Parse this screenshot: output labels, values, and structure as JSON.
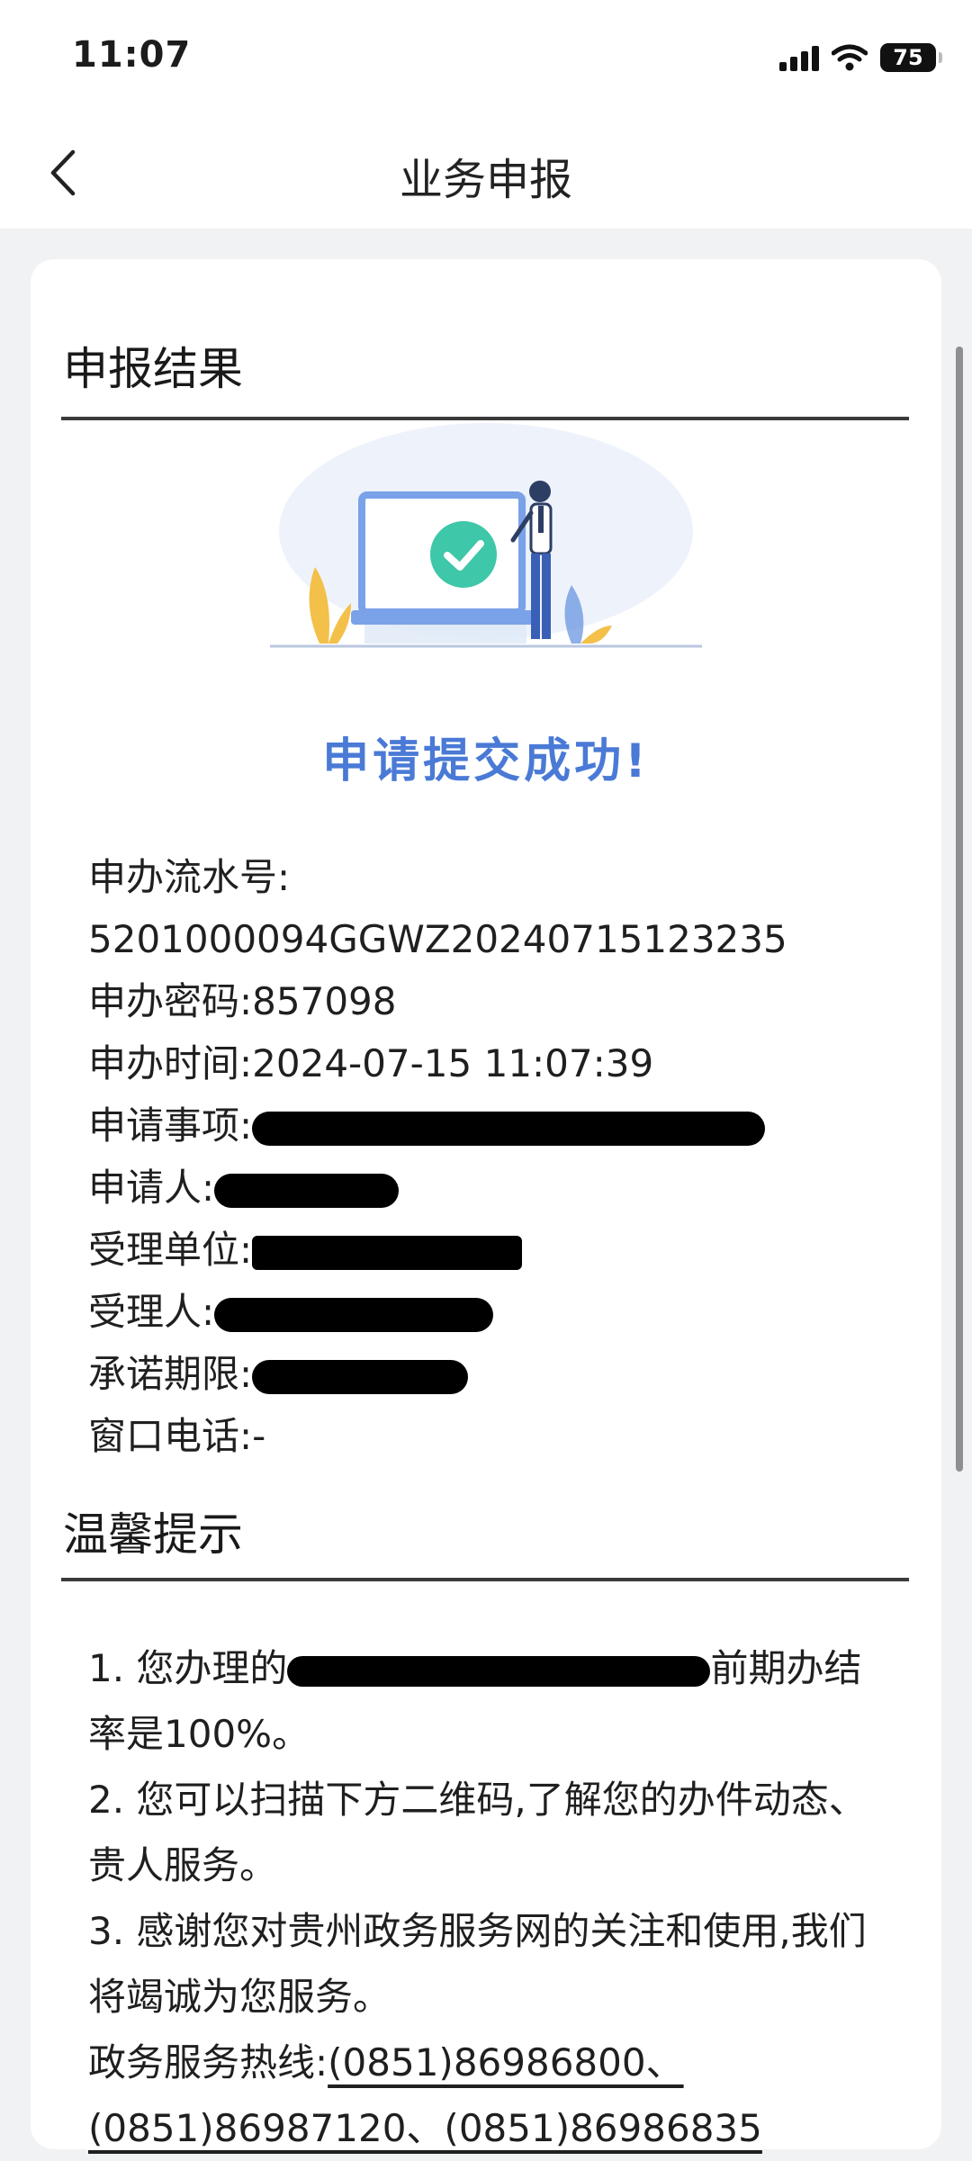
{
  "status_bar": {
    "time": "11:07",
    "battery": "75"
  },
  "nav": {
    "title": "业务申报"
  },
  "result": {
    "section_title": "申报结果",
    "success_message": "申请提交成功!",
    "serial_label": "申办流水号:",
    "serial_value": "5201000094GGWZ20240715123235",
    "password_label": "申办密码:",
    "password_value": "857098",
    "time_label": "申办时间:",
    "time_value": "2024-07-15 11:07:39",
    "item_label": "申请事项:",
    "applicant_label": "申请人:",
    "unit_label": "受理单位:",
    "handler_label": "受理人:",
    "deadline_label": "承诺期限:",
    "phone_label": "窗口电话:",
    "phone_value": "-"
  },
  "tips": {
    "section_title": "温馨提示",
    "tip1_prefix": "1. 您办理的",
    "tip1_suffix": "前期办结率是100%。",
    "tip2": "2. 您可以扫描下方二维码,了解您的办件动态、贵人服务。",
    "tip3": "3. 感谢您对贵州政务服务网的关注和使用,我们将竭诚为您服务。",
    "hotline_label": "政务服务热线:",
    "hotline_numbers": "(0851)86986800、(0851)86987120、(0851)86986835"
  },
  "colors": {
    "accent": "#4a7ad6",
    "background": "#f1f2f4",
    "card": "#ffffff"
  },
  "icons": [
    "back-chevron-icon",
    "signal-icon",
    "wifi-icon",
    "battery-icon",
    "success-check-icon"
  ]
}
